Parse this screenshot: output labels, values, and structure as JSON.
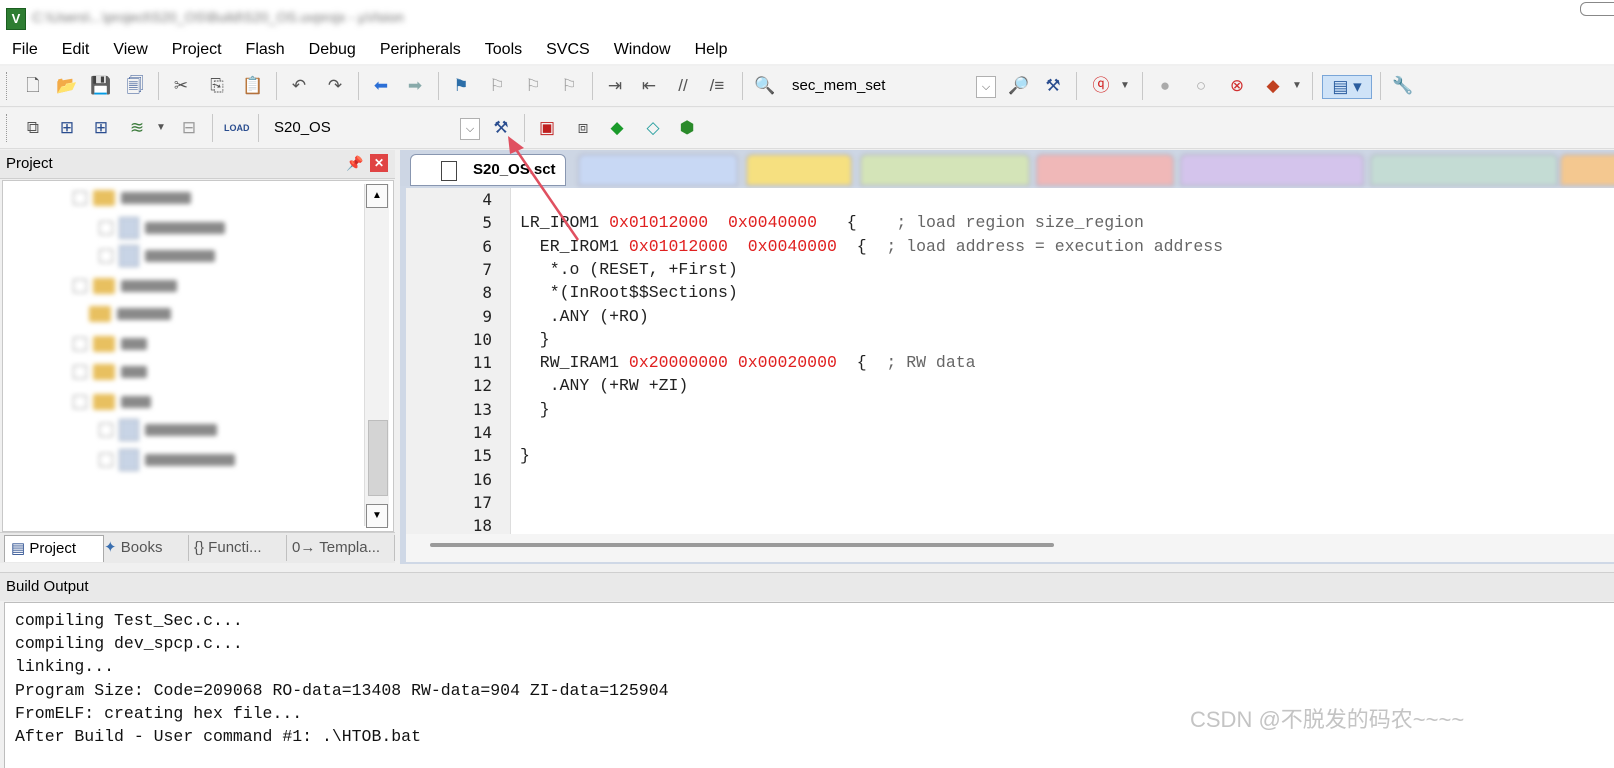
{
  "window": {
    "title": "C:\\Users\\...\\project\\S20_OS\\Build\\S20_OS.uvprojx - µVision"
  },
  "menu": [
    "File",
    "Edit",
    "View",
    "Project",
    "Flash",
    "Debug",
    "Peripherals",
    "Tools",
    "SVCS",
    "Window",
    "Help"
  ],
  "toolbar": {
    "find_combo_value": "sec_mem_set",
    "target_combo_value": "S20_OS",
    "load_label": "LOAD"
  },
  "project_panel": {
    "title": "Project",
    "tabs": [
      "Project",
      "Books",
      "{} Functi...",
      "0→ Templa..."
    ]
  },
  "editor": {
    "active_tab": "S20_OS.sct",
    "lines": [
      {
        "n": "4",
        "text": ""
      },
      {
        "n": "5",
        "text": "LR_IROM1 0x01012000  0x0040000   {    ; load region size_region"
      },
      {
        "n": "6",
        "text": "  ER_IROM1 0x01012000  0x0040000  {  ; load address = execution address"
      },
      {
        "n": "7",
        "text": "   *.o (RESET, +First)"
      },
      {
        "n": "8",
        "text": "   *(InRoot$$Sections)"
      },
      {
        "n": "9",
        "text": "   .ANY (+RO)"
      },
      {
        "n": "10",
        "text": "  }"
      },
      {
        "n": "11",
        "text": "  RW_IRAM1 0x20000000 0x00020000  {  ; RW data"
      },
      {
        "n": "12",
        "text": "   .ANY (+RW +ZI)"
      },
      {
        "n": "13",
        "text": "  }"
      },
      {
        "n": "14",
        "text": ""
      },
      {
        "n": "15",
        "text": "}"
      },
      {
        "n": "16",
        "text": ""
      },
      {
        "n": "17",
        "text": ""
      },
      {
        "n": "18",
        "text": ""
      }
    ]
  },
  "build_output": {
    "title": "Build Output",
    "lines": [
      "compiling Test_Sec.c...",
      "compiling dev_spcp.c...",
      "linking...",
      "Program Size: Code=209068 RO-data=13408 RW-data=904 ZI-data=125904",
      "FromELF: creating hex file...",
      "After Build - User command #1: .\\HTOB.bat"
    ]
  },
  "watermark": "CSDN @不脱发的码农~~~~",
  "colors": {
    "hex_literal": "#e02020",
    "arrow": "#e05060",
    "close_button": "#e04444"
  }
}
